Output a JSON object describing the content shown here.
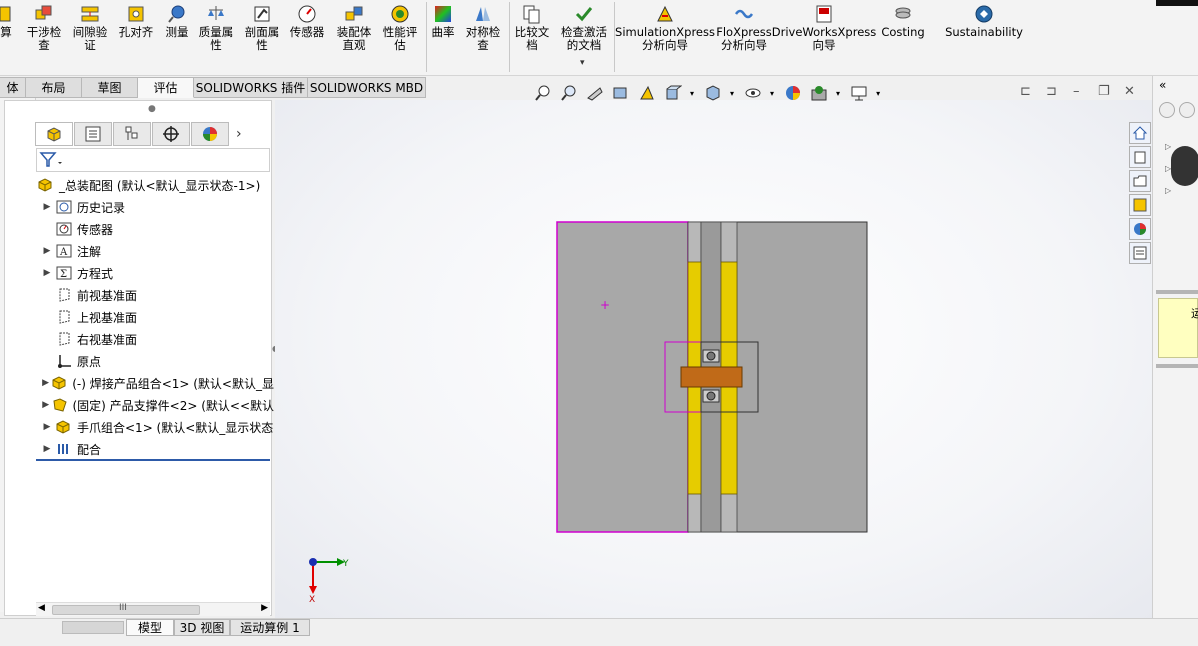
{
  "ribbon": {
    "items": [
      {
        "label": "算",
        "icon": "calc-icon"
      },
      {
        "label": "干涉检\n查",
        "icon": "interference-icon"
      },
      {
        "label": "间隙验\n证",
        "icon": "clearance-icon"
      },
      {
        "label": "孔对齐",
        "icon": "hole-align-icon"
      },
      {
        "label": "测量",
        "icon": "measure-icon"
      },
      {
        "label": "质量属\n性",
        "icon": "mass-icon"
      },
      {
        "label": "剖面属\n性",
        "icon": "section-icon"
      },
      {
        "label": "传感器",
        "icon": "sensor-icon"
      },
      {
        "label": "装配体\n直观",
        "icon": "assembly-visual-icon"
      },
      {
        "label": "性能评\n估",
        "icon": "performance-icon"
      },
      {
        "label": "曲率",
        "icon": "curvature-icon"
      },
      {
        "label": "对称检\n查",
        "icon": "symmetry-icon"
      },
      {
        "label": "比较文\n档",
        "icon": "compare-icon"
      },
      {
        "label": "检查激活\n的文档",
        "icon": "check-doc-icon"
      },
      {
        "label": "SimulationXpress\n分析向导",
        "icon": "simulation-icon"
      },
      {
        "label": "FloXpress\n分析向导",
        "icon": "floxpress-icon"
      },
      {
        "label": "DriveWorksXpress\n向导",
        "icon": "driveworks-icon"
      },
      {
        "label": "Costing",
        "icon": "costing-icon"
      },
      {
        "label": "Sustainability",
        "icon": "sustainability-icon"
      }
    ]
  },
  "tabs": [
    {
      "label": "体"
    },
    {
      "label": "布局"
    },
    {
      "label": "草图"
    },
    {
      "label": "评估"
    },
    {
      "label": "SOLIDWORKS 插件"
    },
    {
      "label": "SOLIDWORKS MBD"
    }
  ],
  "tree": {
    "root": "_总装配图  (默认<默认_显示状态-1>)",
    "items": [
      {
        "label": "历史记录",
        "icon": "history-icon",
        "expandable": true
      },
      {
        "label": "传感器",
        "icon": "sensor-icon",
        "expandable": false
      },
      {
        "label": "注解",
        "icon": "annotation-icon",
        "expandable": true
      },
      {
        "label": "方程式",
        "icon": "equation-icon",
        "expandable": true
      },
      {
        "label": "前视基准面",
        "icon": "plane-icon",
        "expandable": false
      },
      {
        "label": "上视基准面",
        "icon": "plane-icon",
        "expandable": false
      },
      {
        "label": "右视基准面",
        "icon": "plane-icon",
        "expandable": false
      },
      {
        "label": "原点",
        "icon": "origin-icon",
        "expandable": false
      },
      {
        "label": "(-) 焊接产品组合<1> (默认<默认_显",
        "icon": "assembly-icon",
        "expandable": true
      },
      {
        "label": "(固定) 产品支撑件<2> (默认<<默认",
        "icon": "assembly-icon",
        "expandable": true
      },
      {
        "label": "手爪组合<1> (默认<默认_显示状态",
        "icon": "assembly-icon",
        "expandable": true
      },
      {
        "label": "配合",
        "icon": "mate-icon",
        "expandable": true
      }
    ]
  },
  "scroll_label": "III",
  "triad": {
    "x": "X",
    "y": "Y"
  },
  "bottom_tabs": [
    {
      "label": "模型"
    },
    {
      "label": "3D 视图"
    },
    {
      "label": "运动算例 1"
    }
  ],
  "right_pane": {
    "yellow_text": "运"
  },
  "colors": {
    "accent": "#2d5aa8",
    "selection": "#d000d0",
    "part_gray": "#a6a6a6",
    "rail_yellow": "#e8d000",
    "gripper_orange": "#c06a18"
  }
}
